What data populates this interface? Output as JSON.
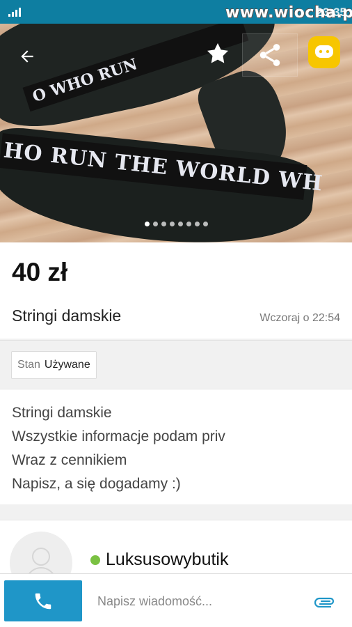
{
  "status_bar": {
    "watermark": "www.wiocha.pl",
    "time": "23:35"
  },
  "photo": {
    "waistband_text": "HO RUN THE WORLD WH",
    "waistband_top_text": "O WHO RUN",
    "slide_count": 8,
    "active_slide": 1
  },
  "listing": {
    "price": "40 zł",
    "title": "Stringi damskie",
    "date": "Wczoraj o 22:54"
  },
  "params": [
    {
      "key": "Stan",
      "value": "Używane"
    }
  ],
  "description": [
    "Stringi damskie",
    "Wszystkie informacje podam priv",
    "Wraz z cennikiem",
    "Napisz, a się dogadamy :)"
  ],
  "seller": {
    "name": "Luksusowybutik",
    "online": true
  },
  "bottom_bar": {
    "message_placeholder": "Napisz wiadomość..."
  },
  "colors": {
    "status_bar": "#0e7ea1",
    "call_button": "#1f96c8",
    "chat_button": "#f7c600",
    "online": "#7ac142",
    "attach_icon": "#1f96c8"
  }
}
